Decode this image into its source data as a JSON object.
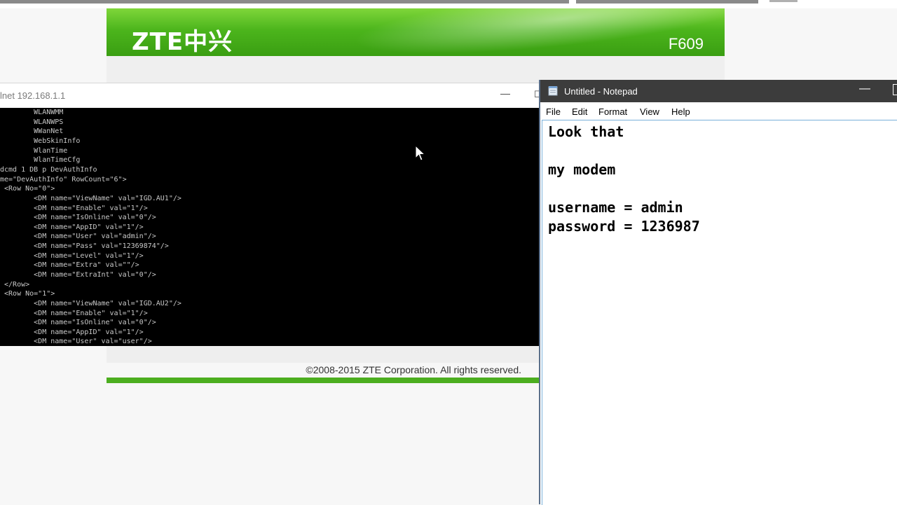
{
  "router_page": {
    "logo": "ZTE中兴",
    "model": "F609",
    "footer": "©2008-2015 ZTE Corporation. All rights reserved.",
    "brand_color": "#4cb51c"
  },
  "telnet_window": {
    "title": "lnet 192.168.1.1",
    "minimize_icon": "minimize-icon",
    "lines": [
      "        WLANWMM",
      "        WLANWPS",
      "        WWanNet",
      "        WebSkinInfo",
      "        WlanTime",
      "        WlanTimeCfg",
      "dcmd 1 DB p DevAuthInfo",
      "me=\"DevAuthInfo\" RowCount=\"6\">",
      " <Row No=\"0\">",
      "        <DM name=\"ViewName\" val=\"IGD.AU1\"/>",
      "        <DM name=\"Enable\" val=\"1\"/>",
      "        <DM name=\"IsOnline\" val=\"0\"/>",
      "        <DM name=\"AppID\" val=\"1\"/>",
      "        <DM name=\"User\" val=\"admin\"/>",
      "        <DM name=\"Pass\" val=\"12369874\"/>",
      "        <DM name=\"Level\" val=\"1\"/>",
      "        <DM name=\"Extra\" val=\"\"/>",
      "        <DM name=\"ExtraInt\" val=\"0\"/>",
      " </Row>",
      " <Row No=\"1\">",
      "        <DM name=\"ViewName\" val=\"IGD.AU2\"/>",
      "        <DM name=\"Enable\" val=\"1\"/>",
      "        <DM name=\"IsOnline\" val=\"0\"/>",
      "        <DM name=\"AppID\" val=\"1\"/>",
      "        <DM name=\"User\" val=\"user\"/>"
    ]
  },
  "notepad": {
    "title": "Untitled - Notepad",
    "menu": [
      "File",
      "Edit",
      "Format",
      "View",
      "Help"
    ],
    "lines": [
      "Look that",
      "",
      "my modem",
      "",
      "username = admin",
      "password = 1236987"
    ]
  }
}
